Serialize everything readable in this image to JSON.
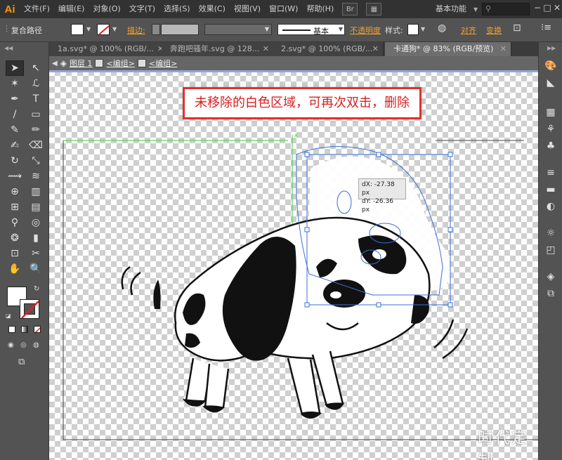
{
  "app": {
    "logo": "Ai"
  },
  "menu": [
    "文件(F)",
    "编辑(E)",
    "对象(O)",
    "文字(T)",
    "选择(S)",
    "效果(C)",
    "视图(V)",
    "窗口(W)",
    "帮助(H)"
  ],
  "menu_icons": {
    "bridge": "Br",
    "arrange": "▦"
  },
  "workspace": {
    "label": "基本功能"
  },
  "window_controls": {
    "minimize": "−",
    "maximize": "□",
    "close": "✕"
  },
  "controlbar": {
    "object_type": "复合路径",
    "stroke_label": "描边:",
    "brush_label": "基本",
    "opacity_label": "不透明度",
    "style_label": "样式:",
    "align_label": "对齐",
    "transform_label": "变换"
  },
  "tabs": [
    {
      "label": "1a.svg* @ 100% (RGB/...",
      "active": false
    },
    {
      "label": "奔跑吧骚年.svg @ 128...",
      "active": false
    },
    {
      "label": "2.svg* @ 100% (RGB/...",
      "active": false
    },
    {
      "label": "卡通狗* @ 83% (RGB/预览)",
      "active": true
    }
  ],
  "breadcrumb": {
    "layer": "图层 1",
    "group1": "<编组>",
    "group2": "<编组>"
  },
  "tools": [
    "selection-icon",
    "direct-selection-icon",
    "magic-wand-icon",
    "lasso-icon",
    "pen-icon",
    "type-icon",
    "line-icon",
    "rectangle-icon",
    "brush-icon",
    "pencil-icon",
    "blob-brush-icon",
    "eraser-icon",
    "rotate-icon",
    "scale-icon",
    "width-icon",
    "warp-icon",
    "shape-builder-icon",
    "perspective-icon",
    "mesh-icon",
    "gradient-icon",
    "eyedropper-icon",
    "blend-icon",
    "symbol-sprayer-icon",
    "graph-icon",
    "artboard-icon",
    "slice-icon",
    "hand-icon",
    "zoom-icon"
  ],
  "tool_glyphs": [
    "➤",
    "↖",
    "✶",
    "ℒ",
    "✒",
    "T",
    "/",
    "▭",
    "✎",
    "✏",
    "✍",
    "⌫",
    "↻",
    "⤡",
    "⟿",
    "≋",
    "⊕",
    "▥",
    "⊞",
    "▤",
    "⚲",
    "◎",
    "❂",
    "▮",
    "⊡",
    "✂",
    "✋",
    "🔍"
  ],
  "right_panel_icons": [
    "color-icon",
    "color-guide-icon",
    "swatches-icon",
    "brushes-icon",
    "symbols-icon",
    "stroke-icon",
    "gradient-icon",
    "transparency-icon",
    "appearance-icon",
    "graphic-styles-icon",
    "layers-icon",
    "artboards-icon"
  ],
  "right_panel_glyphs": [
    "🎨",
    "◣",
    "▦",
    "⚘",
    "♣",
    "≡",
    "▬",
    "◐",
    "☼",
    "◰",
    "◈",
    "⧉"
  ],
  "canvas": {
    "annotation": "未移除的白色区域，可再次双击，删除",
    "tooltip_dx": "dX: -27.38 px",
    "tooltip_dy": "dY: -26.36 px",
    "watermark": "时代定制"
  },
  "colors": {
    "annotation_border": "#e03030",
    "selection_blue": "#3a6fd8",
    "guide_green": "#3fcf3f",
    "accent_orange": "#ff9a00"
  }
}
